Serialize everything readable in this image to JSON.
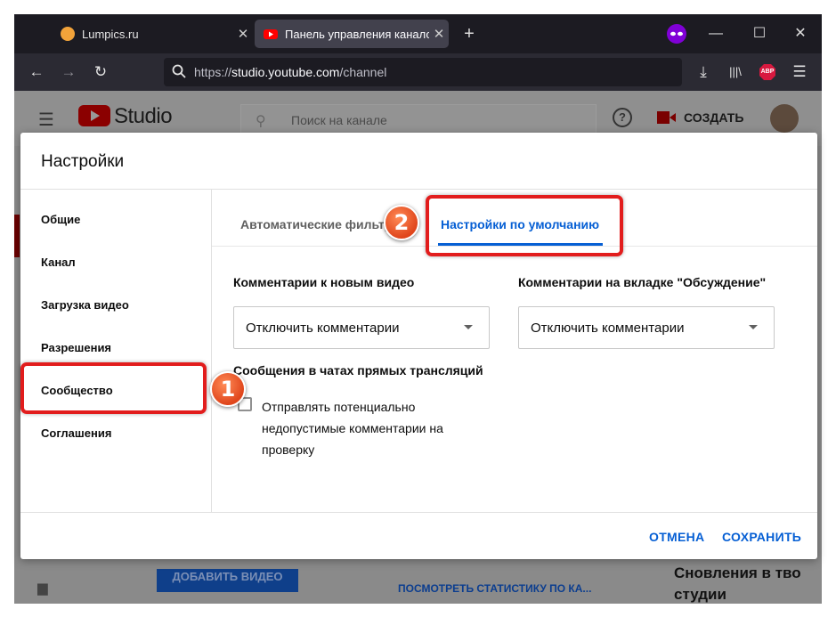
{
  "browser": {
    "tabs": [
      {
        "title": "Lumpics.ru",
        "favicon": "lumpics-favicon"
      },
      {
        "title": "Панель управления каналом",
        "favicon": "youtube-favicon",
        "active": true
      }
    ],
    "url": {
      "scheme": "https://",
      "host": "studio.youtube.com",
      "path": "/channel"
    },
    "adblock_label": "ABP"
  },
  "youtube": {
    "logo_text": "Studio",
    "search_placeholder": "Поиск на канале",
    "create_label": "СОЗДАТЬ",
    "bg_button_label": "ДОБАВИТЬ ВИДЕО",
    "bg_link_label": "ПОСМОТРЕТЬ СТАТИСТИКУ ПО КА...",
    "bg_text_line1": "Сновления в тво",
    "bg_text_line2": "студии"
  },
  "dialog": {
    "title": "Настройки",
    "sidebar": [
      "Общие",
      "Канал",
      "Загрузка видео",
      "Разрешения",
      "Сообщество",
      "Соглашения"
    ],
    "tabs": [
      "Автоматические фильтры",
      "Настройки по умолчанию"
    ],
    "new_video_comments": {
      "label": "Комментарии к новым видео",
      "value": "Отключить комментарии"
    },
    "discussion_comments": {
      "label": "Комментарии на вкладке \"Обсуждение\"",
      "value": "Отключить комментарии"
    },
    "live_chat": {
      "label": "Сообщения в чатах прямых трансляций",
      "checkbox_label": "Отправлять потенциально недопустимые комментарии на проверку",
      "checked": false
    },
    "cancel_label": "ОТМЕНА",
    "save_label": "СОХРАНИТЬ"
  },
  "annotations": {
    "badge1": "1",
    "badge2": "2",
    "color": "#e21d1d"
  }
}
